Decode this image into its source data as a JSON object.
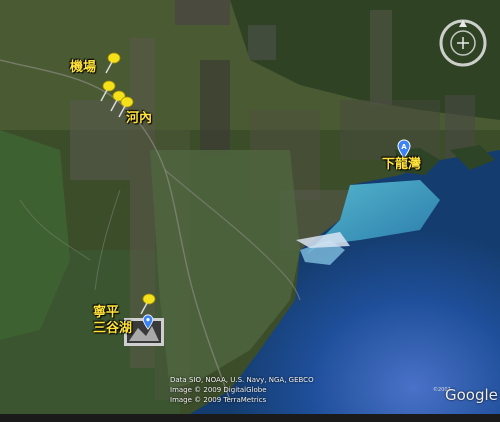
{
  "labels": {
    "airport": "機場",
    "hanoi": "河內",
    "halong": "下龍灣",
    "ninhbinh_line1": "寧平",
    "ninhbinh_line2": "三谷湖"
  },
  "placemark_a": "A",
  "attribution": {
    "line1": "Data SIO, NOAA, U.S. Navy, NGA, GEBCO",
    "line2": "Image © 2009 DigitalGlobe",
    "line3": "Image © 2009 TerraMetrics"
  },
  "google_logo": "Google",
  "google_copy": "©2007",
  "statusbar": "",
  "colors": {
    "label": "#ffe23a",
    "pin": "#f5e11a",
    "placemark": "#3b82f6",
    "sea": "#1b5fa0"
  },
  "icons": [
    "pushpin-icon",
    "placemark-icon",
    "compass-icon",
    "photo-icon"
  ]
}
